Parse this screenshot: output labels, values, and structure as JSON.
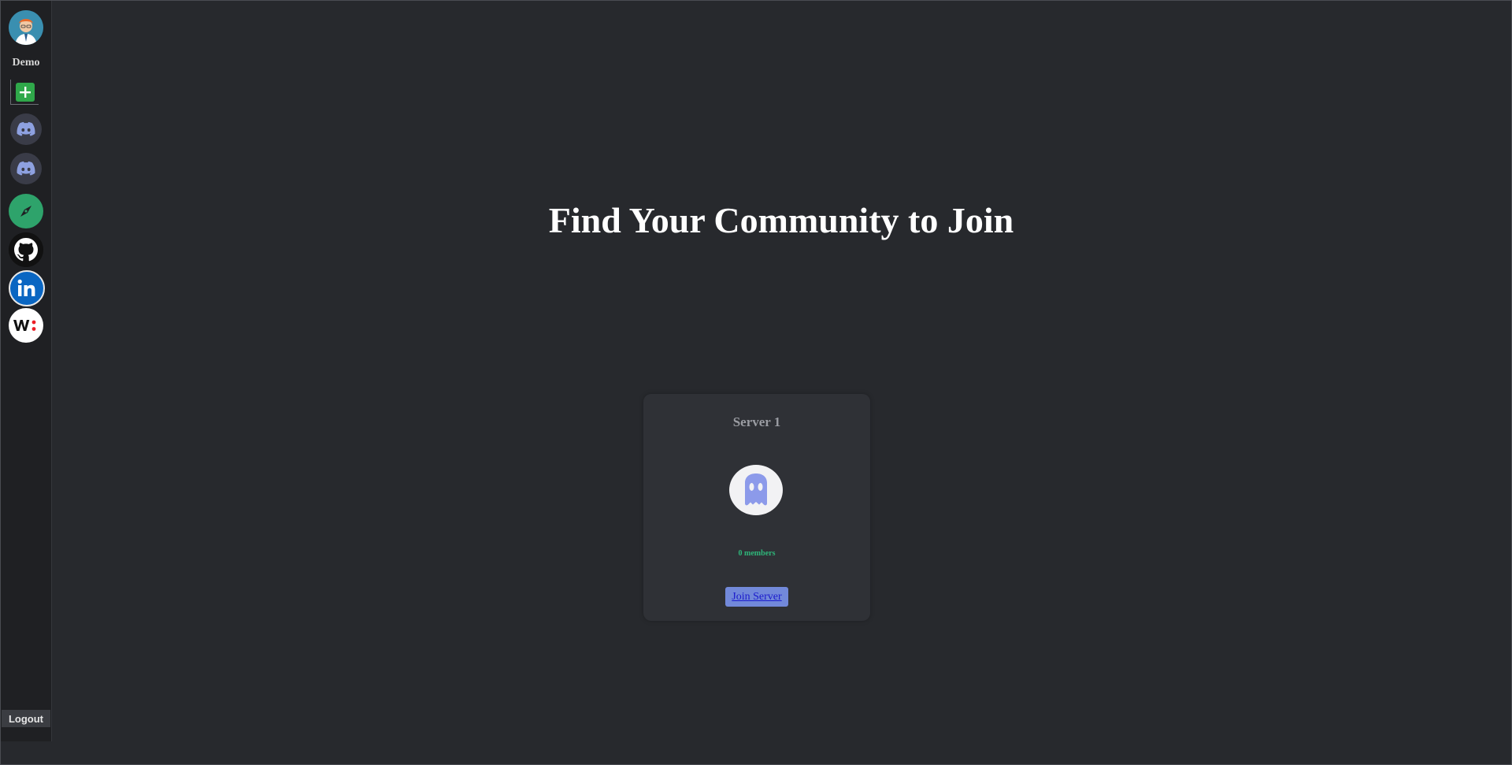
{
  "sidebar": {
    "user_label": "Demo",
    "items": [
      {
        "name": "avatar",
        "icon": "user-avatar-icon"
      },
      {
        "name": "add-server",
        "icon": "plus-icon"
      },
      {
        "name": "server-a",
        "icon": "discord-icon"
      },
      {
        "name": "server-b",
        "icon": "discord-icon"
      },
      {
        "name": "explore",
        "icon": "compass-icon"
      },
      {
        "name": "github",
        "icon": "github-icon"
      },
      {
        "name": "linkedin",
        "icon": "linkedin-icon"
      },
      {
        "name": "wellfound",
        "icon": "wellfound-icon"
      }
    ],
    "logout_label": "Logout"
  },
  "main": {
    "title": "Find Your Community to Join"
  },
  "servers": [
    {
      "name": "Server 1",
      "members": "0 members",
      "join_label": "Join Server",
      "icon": "discord-icon"
    }
  ],
  "colors": {
    "background": "#27292d",
    "sidebar": "#1f2023",
    "card": "#2f3136",
    "accent": "#7289da",
    "members_green": "#2fb67a",
    "add_green": "#2fa84a"
  }
}
